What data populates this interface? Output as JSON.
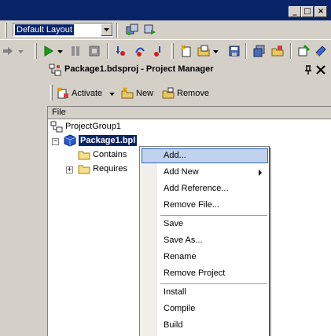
{
  "toolbar": {
    "layout_value": "Default Layout"
  },
  "pane": {
    "title": "Package1.bdsproj - Project Manager",
    "pin_icon": "pin-icon",
    "close_icon": "close-icon"
  },
  "pm_toolbar": {
    "activate_label": "Activate",
    "new_label": "New",
    "remove_label": "Remove"
  },
  "tree": {
    "header": "File",
    "group_label": "ProjectGroup1",
    "package_label": "Package1.bpl",
    "contains_label": "Contains",
    "requires_label": "Requires"
  },
  "context_menu": {
    "items": [
      {
        "label": "Add...",
        "selected": true
      },
      {
        "label": "Add New",
        "submenu": true
      },
      {
        "label": "Add Reference..."
      },
      {
        "label": "Remove File..."
      },
      {
        "label": "Save"
      },
      {
        "label": "Save As..."
      },
      {
        "label": "Rename"
      },
      {
        "label": "Remove Project"
      },
      {
        "label": "Install"
      },
      {
        "label": "Compile"
      },
      {
        "label": "Build"
      }
    ]
  },
  "colors": {
    "selection": "#0a246a",
    "menu_highlight": "#c1d2ee",
    "menu_highlight_border": "#316ac5",
    "face": "#d4d0c8"
  }
}
